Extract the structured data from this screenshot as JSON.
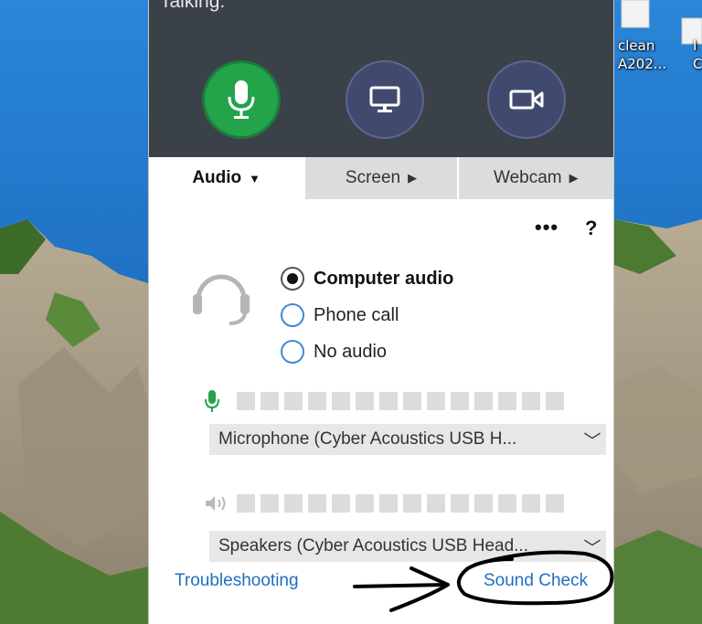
{
  "desktop": {
    "icon1_label_line1": "clean",
    "icon1_label_line2": "A202...",
    "icon2_label_line1": "I",
    "icon2_label_line2": "C"
  },
  "header": {
    "status_text": "Talking:",
    "buttons": [
      "microphone-icon",
      "monitor-icon",
      "camera-icon"
    ],
    "mic_color": "#23a34a",
    "dark_bg": "#3b4148"
  },
  "tabs": [
    {
      "label": "Audio",
      "caret": "▼"
    },
    {
      "label": "Screen",
      "caret": "▶"
    },
    {
      "label": "Webcam",
      "caret": "▶"
    }
  ],
  "toolbar": {
    "more": "•••",
    "help": "?"
  },
  "audio_options": [
    {
      "label": "Computer audio",
      "selected": true
    },
    {
      "label": "Phone call",
      "selected": false
    },
    {
      "label": "No audio",
      "selected": false
    }
  ],
  "devices": {
    "microphone": "Microphone (Cyber Acoustics USB H...",
    "speakers": "Speakers (Cyber Acoustics USB Head...",
    "chevron": "﹀"
  },
  "links": {
    "troubleshooting": "Troubleshooting",
    "sound_check": "Sound Check"
  },
  "accent": "#1f6fc0"
}
